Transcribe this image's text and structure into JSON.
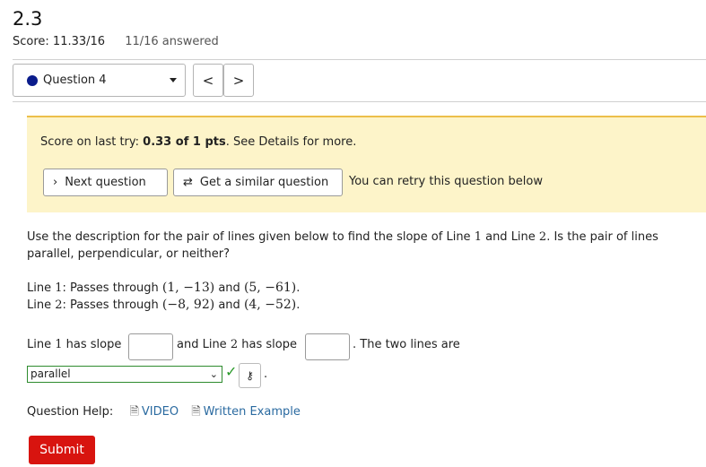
{
  "header": {
    "title": "2.3",
    "score": "Score: 11.33/16",
    "answered": "11/16 answered"
  },
  "nav": {
    "question_label": "Question 4",
    "prev": "<",
    "next": ">"
  },
  "banner": {
    "prefix": "Score on last try: ",
    "score": "0.33 of 1 pts",
    "suffix": ". See Details for more.",
    "next_question": "Next question",
    "similar_question": "Get a similar question",
    "retry_text": "You can retry this question below"
  },
  "question": {
    "text_a": "Use the description for the pair of lines given below to find the slope of Line ",
    "n1": "1",
    "text_b": " and Line ",
    "n2": "2",
    "text_c": ". Is the pair of lines parallel, perpendicular, or neither?",
    "line1_label": "Line ",
    "line1_num": "1",
    "line1_mid": ": Passes through ",
    "line1_p1": "(1, −13)",
    "line1_and": " and ",
    "line1_p2": "(5, −61)",
    "line1_end": ".",
    "line2_label": "Line ",
    "line2_num": "2",
    "line2_mid": ": Passes through ",
    "line2_p1": "(−8, 92)",
    "line2_and": " and ",
    "line2_p2": "(4, −52)",
    "line2_end": "."
  },
  "answer": {
    "pre1": "Line ",
    "num1": "1",
    "has_slope1": " has slope",
    "and_line": "and Line ",
    "num2": "2",
    "has_slope2": " has slope",
    "tail": ". The two lines are",
    "slope1_value": "",
    "slope2_value": "",
    "selection": "parallel",
    "period": "."
  },
  "help": {
    "label": "Question Help:",
    "video": "VIDEO",
    "example": "Written Example"
  },
  "submit_label": "Submit",
  "colors": {
    "accent_submit": "#d8140f",
    "banner_bg": "#fdf4c9",
    "correct": "#2a9a2a",
    "link": "#2a6aa0"
  }
}
